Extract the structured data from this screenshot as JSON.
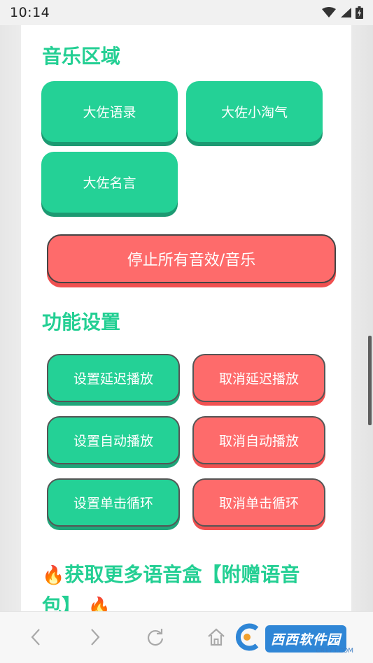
{
  "status_bar": {
    "time": "10:14"
  },
  "music_section": {
    "title": "音乐区域",
    "buttons": [
      {
        "label": "大佐语录"
      },
      {
        "label": "大佐小淘气"
      },
      {
        "label": "大佐名言"
      }
    ],
    "stop_all_label": "停止所有音效/音乐"
  },
  "settings_section": {
    "title": "功能设置",
    "rows": [
      {
        "set_label": "设置延迟播放",
        "cancel_label": "取消延迟播放"
      },
      {
        "set_label": "设置自动播放",
        "cancel_label": "取消自动播放"
      },
      {
        "set_label": "设置单击循环",
        "cancel_label": "取消单击循环"
      }
    ]
  },
  "footer": {
    "emoji_left": "🔥",
    "text": "获取更多语音盒【附赠语音包】",
    "emoji_right": "🔥"
  },
  "watermark": {
    "logo_text": "西西软件园",
    "site": "CR173.COM"
  },
  "colors": {
    "accent_green": "#24d196",
    "accent_red": "#fe6b6b",
    "title_green": "#23cf93"
  }
}
